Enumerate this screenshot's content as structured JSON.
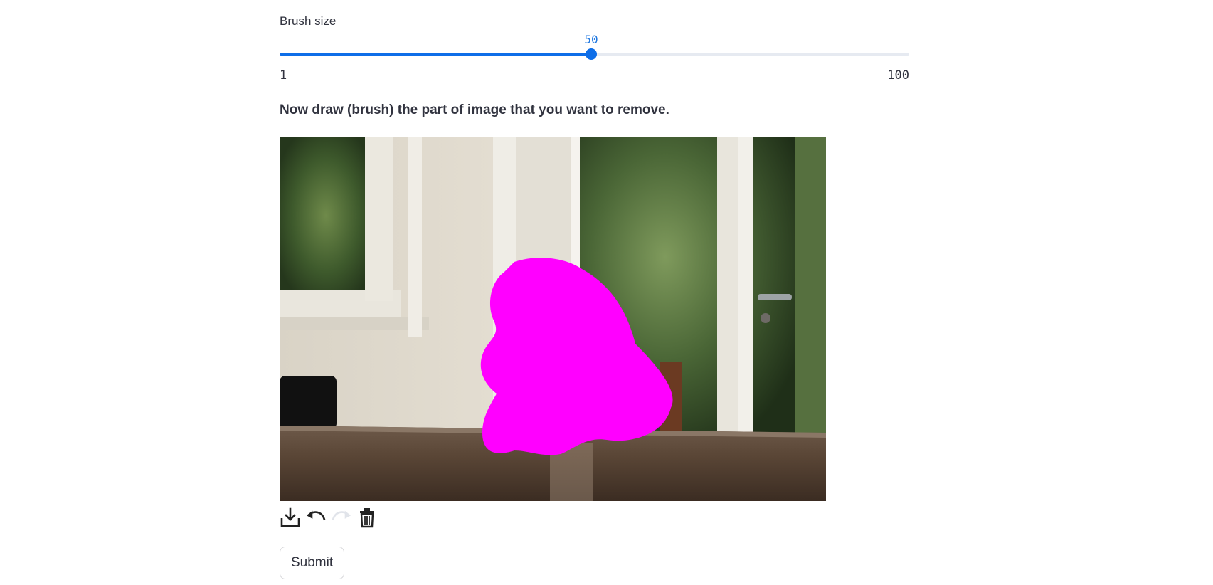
{
  "slider": {
    "label": "Brush size",
    "value": "50",
    "min": "1",
    "max": "100",
    "fill_fraction": 0.495
  },
  "instruction": "Now draw (brush) the part of image that you want to remove.",
  "canvas": {
    "image_description_icon": "kitchen-table-photo",
    "mask_color": "#ff00ff"
  },
  "toolbar": {
    "icons": [
      "download-icon",
      "undo-icon",
      "redo-icon",
      "trash-icon"
    ]
  },
  "submit": {
    "label": "Submit"
  },
  "colors": {
    "accent": "#0e6ee8",
    "track": "#e6eaf1",
    "text": "#31333f",
    "mask": "#ff00ff"
  }
}
